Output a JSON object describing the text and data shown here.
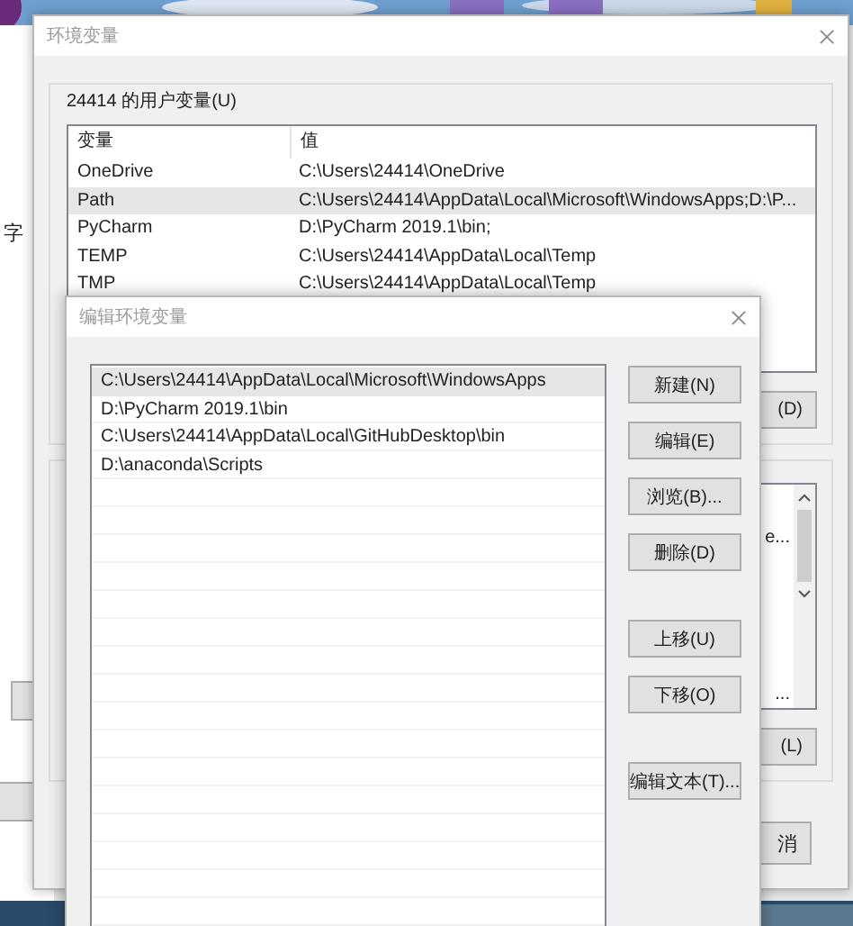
{
  "left_window": {
    "partial_label": "字"
  },
  "env_window": {
    "title": "环境变量",
    "user_group": {
      "title": "24414 的用户变量(U)",
      "columns": [
        "变量",
        "值"
      ],
      "rows": [
        {
          "name": "OneDrive",
          "value": "C:\\Users\\24414\\OneDrive",
          "selected": false
        },
        {
          "name": "Path",
          "value": "C:\\Users\\24414\\AppData\\Local\\Microsoft\\WindowsApps;D:\\P...",
          "selected": true
        },
        {
          "name": "PyCharm",
          "value": "D:\\PyCharm 2019.1\\bin;",
          "selected": false
        },
        {
          "name": "TEMP",
          "value": "C:\\Users\\24414\\AppData\\Local\\Temp",
          "selected": false
        },
        {
          "name": "TMP",
          "value": "C:\\Users\\24414\\AppData\\Local\\Temp",
          "selected": false
        }
      ],
      "button_partial": "(D)"
    },
    "system_group": {
      "cells": [
        "e...",
        "..."
      ],
      "button_partial": "(L)"
    },
    "bottom_button_partial": "消"
  },
  "edit_dialog": {
    "title": "编辑环境变量",
    "entries": [
      {
        "text": "C:\\Users\\24414\\AppData\\Local\\Microsoft\\WindowsApps",
        "selected": true
      },
      {
        "text": "D:\\PyCharm 2019.1\\bin",
        "selected": false
      },
      {
        "text": "C:\\Users\\24414\\AppData\\Local\\GitHubDesktop\\bin",
        "selected": false
      },
      {
        "text": "D:\\anaconda\\Scripts",
        "selected": false
      }
    ],
    "button_groups": [
      [
        "新建(N)",
        "编辑(E)",
        "浏览(B)...",
        "删除(D)"
      ],
      [
        "上移(U)",
        "下移(O)"
      ],
      [
        "编辑文本(T)..."
      ]
    ]
  }
}
